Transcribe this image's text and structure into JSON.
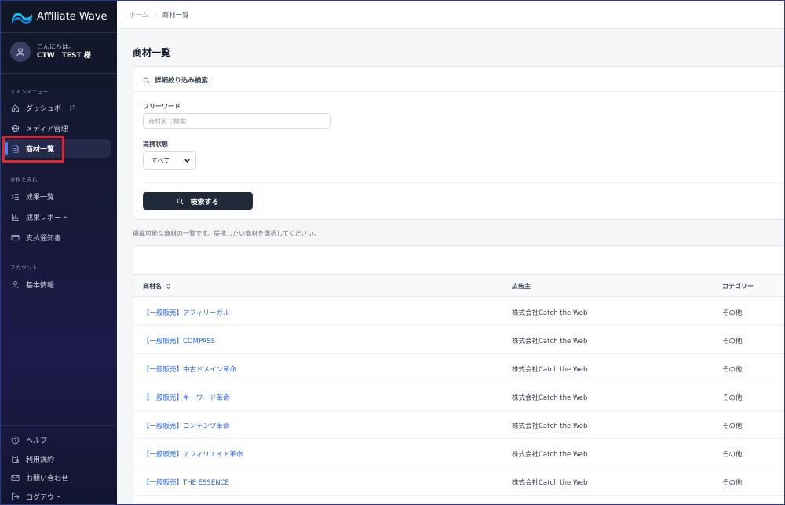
{
  "app": {
    "name": "Affiliate Wave"
  },
  "user": {
    "greeting": "こんにちは。",
    "name": "CTW　TEST 様"
  },
  "sidebar": {
    "sections": [
      {
        "label": "メインメニュー",
        "items": [
          {
            "label": "ダッシュボード",
            "icon": "home-icon"
          },
          {
            "label": "メディア管理",
            "icon": "globe-icon"
          },
          {
            "label": "商材一覧",
            "icon": "document-icon",
            "active": true
          }
        ]
      },
      {
        "label": "分析と支払",
        "items": [
          {
            "label": "成果一覧",
            "icon": "list-icon"
          },
          {
            "label": "成果レポート",
            "icon": "bar-chart-icon"
          },
          {
            "label": "支払通知書",
            "icon": "credit-card-icon"
          }
        ]
      },
      {
        "label": "アカウント",
        "items": [
          {
            "label": "基本情報",
            "icon": "user-icon"
          }
        ]
      }
    ],
    "footer": [
      {
        "label": "ヘルプ",
        "icon": "help-icon"
      },
      {
        "label": "利用規約",
        "icon": "scale-icon"
      },
      {
        "label": "お問い合わせ",
        "icon": "mail-icon"
      },
      {
        "label": "ログアウト",
        "icon": "logout-icon"
      }
    ]
  },
  "breadcrumb": {
    "home": "ホーム",
    "separator": "›",
    "current": "商材一覧"
  },
  "page": {
    "title": "商材一覧",
    "description": "掲載可能な商材の一覧です。提携したい商材を選択してください。"
  },
  "search": {
    "header": "詳細絞り込み検索",
    "freeword_label": "フリーワード",
    "freeword_placeholder": "商材名で検索",
    "freeword_value": "",
    "status_label": "提携状態",
    "status_selected": "すべて",
    "submit_label": "検索する"
  },
  "table": {
    "columns": [
      "商材名",
      "広告主",
      "カテゴリー"
    ],
    "rows": [
      {
        "name": "【一般販売】アフィリーガル",
        "advertiser": "株式会社Catch the Web",
        "category": "その他"
      },
      {
        "name": "【一般販売】COMPASS",
        "advertiser": "株式会社Catch the Web",
        "category": "その他"
      },
      {
        "name": "【一般販売】中古ドメイン革命",
        "advertiser": "株式会社Catch the Web",
        "category": "その他"
      },
      {
        "name": "【一般販売】キーワード革命",
        "advertiser": "株式会社Catch the Web",
        "category": "その他"
      },
      {
        "name": "【一般販売】コンテンツ革命",
        "advertiser": "株式会社Catch the Web",
        "category": "その他"
      },
      {
        "name": "【一般販売】アフィリエイト革命",
        "advertiser": "株式会社Catch the Web",
        "category": "その他"
      },
      {
        "name": "【一般販売】THE ESSENCE",
        "advertiser": "株式会社Catch the Web",
        "category": "その他"
      }
    ]
  },
  "colors": {
    "sidebar_bg": "#141733",
    "accent": "#4f7cff",
    "link": "#2563eb",
    "button_bg": "#1f2937",
    "highlight_box": "#e3262b"
  }
}
